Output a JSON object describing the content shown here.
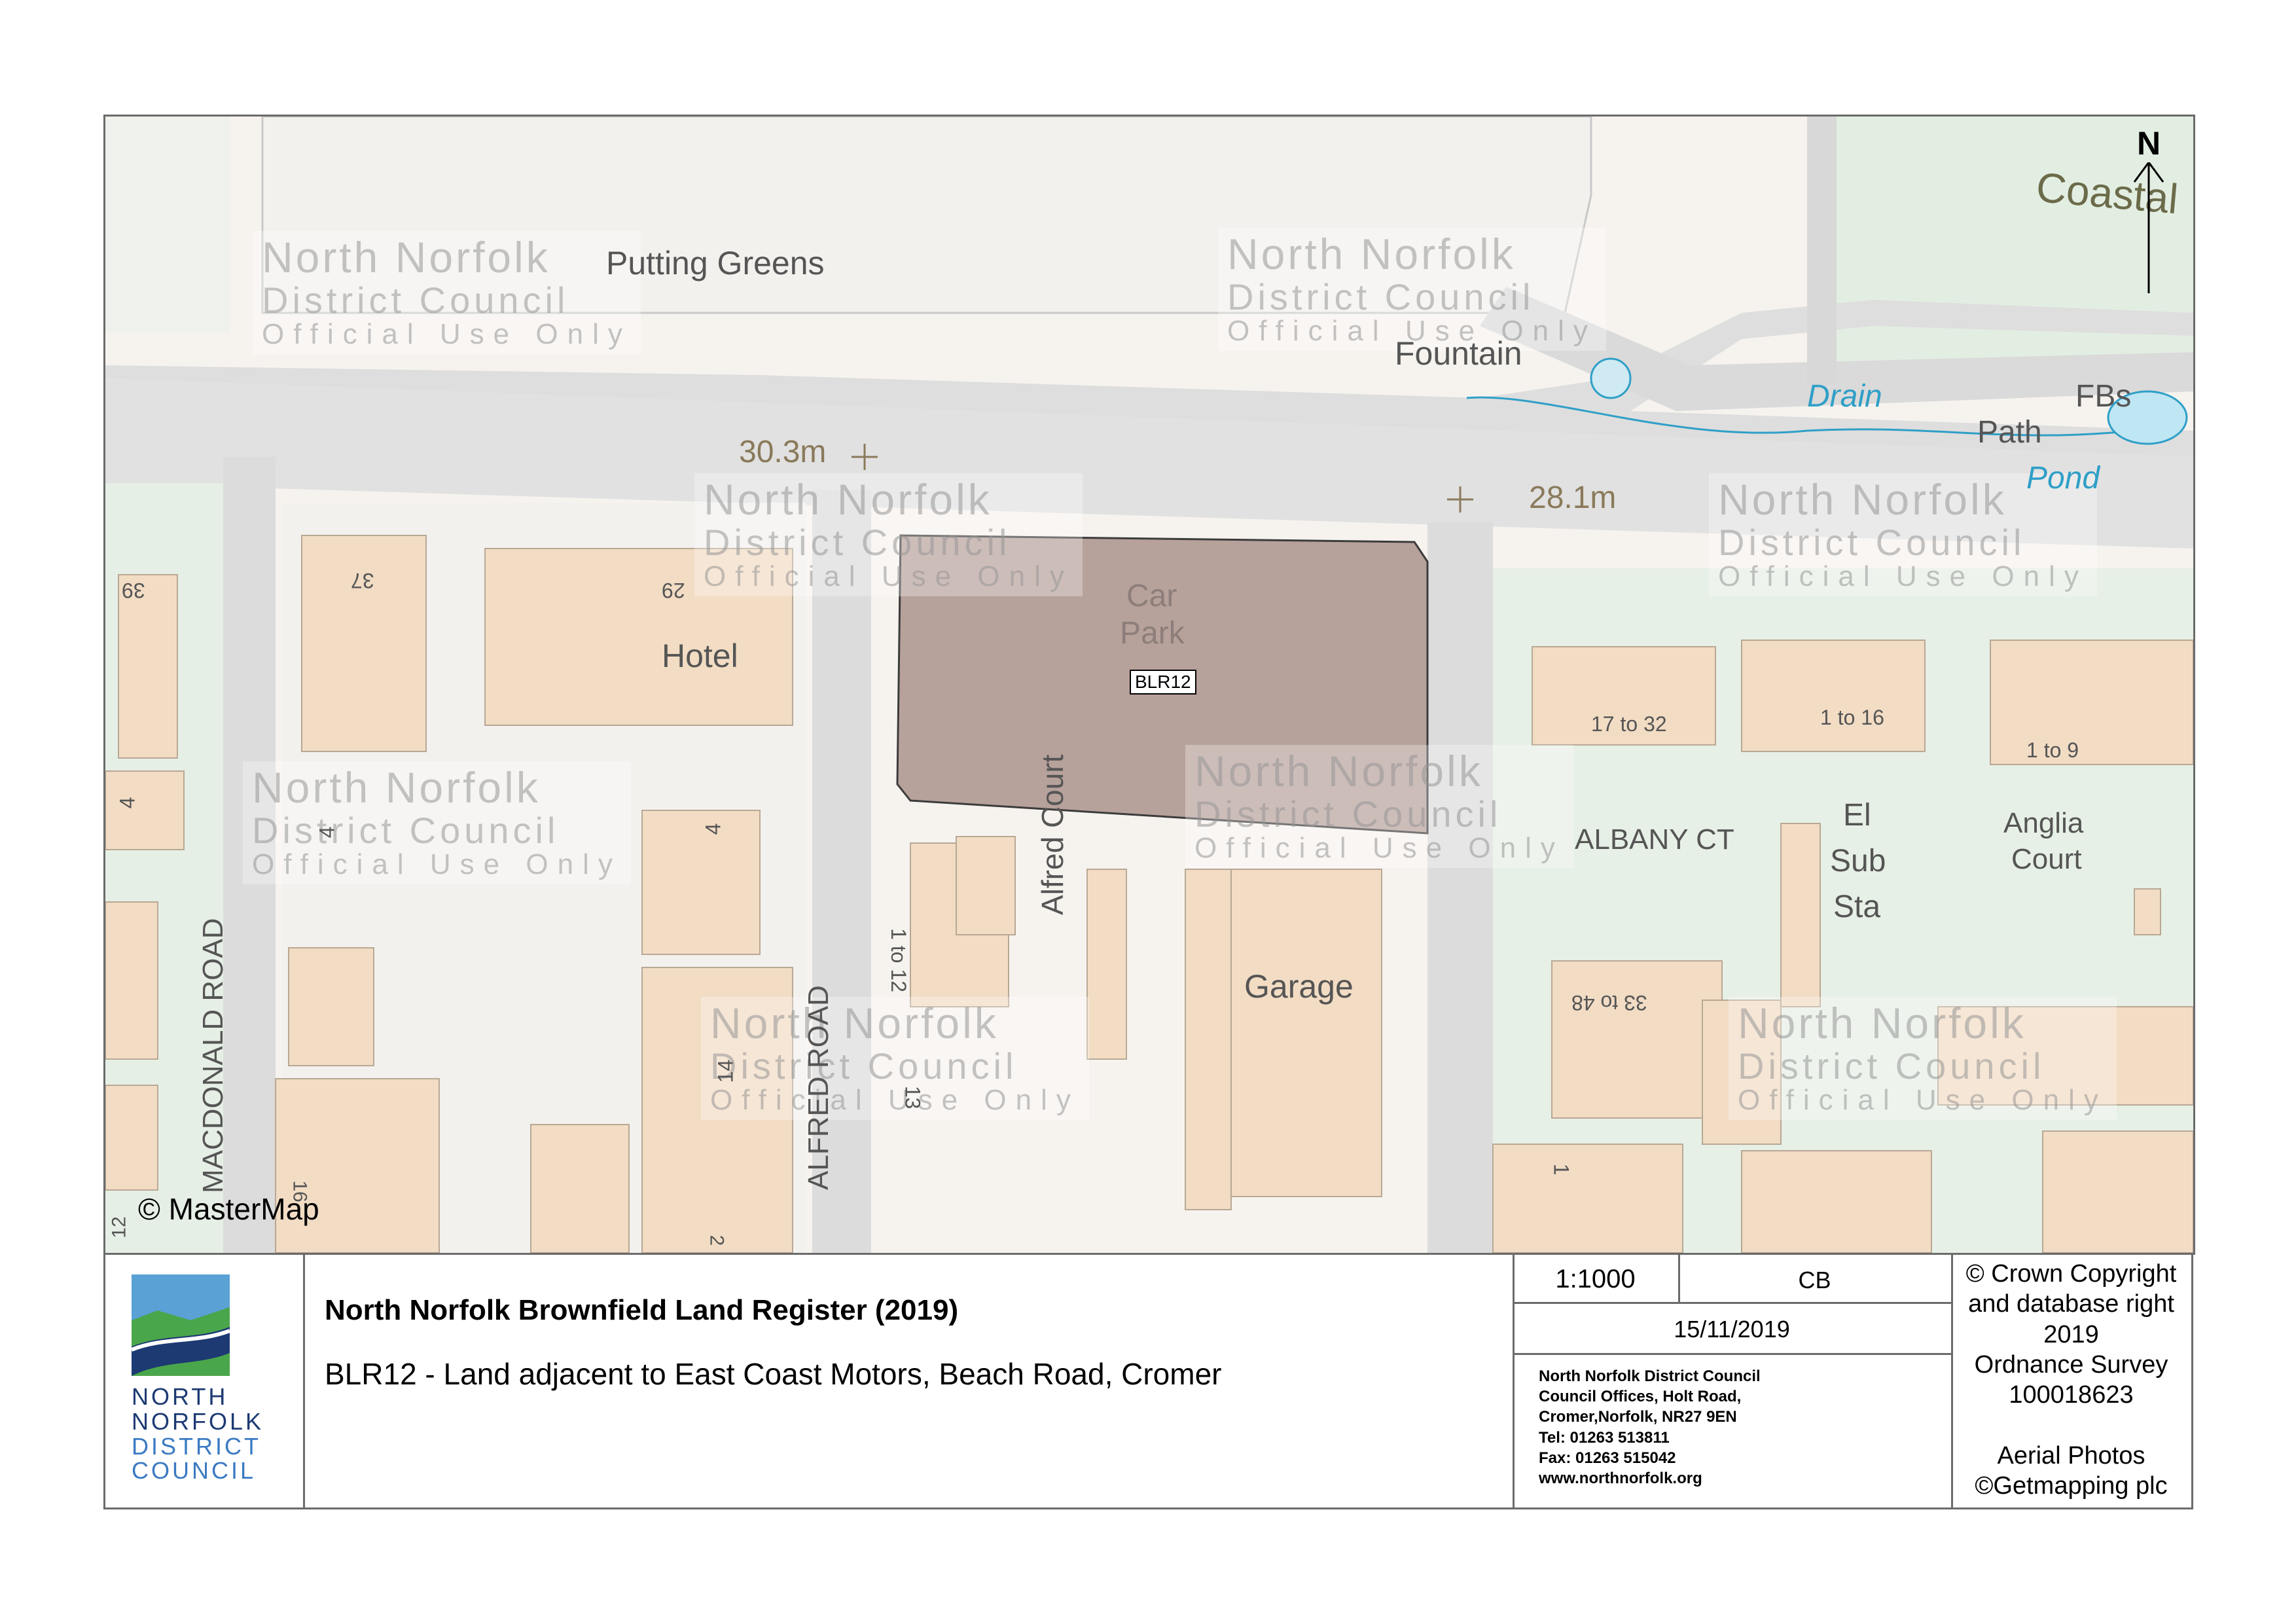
{
  "map": {
    "labels": {
      "putting_greens": "Putting Greens",
      "fountain": "Fountain",
      "drain": "Drain",
      "fbs": "FBs",
      "path": "Path",
      "pond": "Pond",
      "coastal": "Coastal",
      "car": "Car",
      "park": "Park",
      "hotel": "Hotel",
      "garage": "Garage",
      "albany_ct": "ALBANY CT",
      "el": "El",
      "sub": "Sub",
      "sta": "Sta",
      "anglia": "Anglia",
      "court": "Court",
      "alfred_court": "Alfred Court",
      "macdonald_road": "MACDONALD ROAD",
      "alfred_road": "ALFRED ROAD",
      "spot_height_1": "30.3m",
      "spot_height_2": "28.1m",
      "site_ref": "BLR12",
      "mastermap": "© MasterMap",
      "north": "N"
    },
    "house_numbers": {
      "n39": "39",
      "n37": "37",
      "n29": "29",
      "n4a": "4",
      "n4b": "4",
      "n4c": "4",
      "n14": "14",
      "n1to12": "1 to 12",
      "n13": "13",
      "n17to32": "17 to 32",
      "n1to16": "1 to 16",
      "n1to9": "1 to 9",
      "n33to48": "33 to 48",
      "n1": "1",
      "n12": "12",
      "n16": "16",
      "n2": "2"
    },
    "watermark": {
      "line1": "North Norfolk",
      "line2": "District Council",
      "line3": "Official Use Only"
    },
    "colors": {
      "site_fill": "#b49d97",
      "building": "#f2dcc4",
      "road": "#dcdcdc",
      "green": "#e4efe3",
      "water": "#2f9fc7"
    }
  },
  "title_block": {
    "logo_lines": [
      "NORTH",
      "NORFOLK",
      "DISTRICT",
      "COUNCIL"
    ],
    "title": "North Norfolk Brownfield Land Register (2019)",
    "subtitle": "BLR12 - Land adjacent to East Coast Motors, Beach Road, Cromer",
    "scale": "1:1000",
    "initials": "CB",
    "date": "15/11/2019",
    "address_lines": [
      "North Norfolk District Council",
      "Council Offices, Holt Road,",
      "Cromer,Norfolk, NR27 9EN",
      "Tel: 01263 513811",
      "Fax: 01263 515042",
      "www.northnorfolk.org"
    ],
    "copyright_lines": [
      "© Crown Copyright",
      "and database right",
      "2019",
      "Ordnance Survey",
      "100018623"
    ],
    "aerial_lines": [
      "Aerial Photos",
      "©Getmapping plc"
    ]
  }
}
